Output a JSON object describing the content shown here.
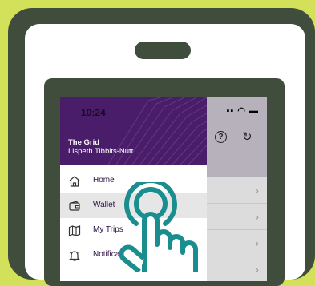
{
  "drawer": {
    "time": "10:24",
    "app_name": "The Grid",
    "user_name": "Lispeth Tibbits-Nutt",
    "items": [
      {
        "label": "Home",
        "icon": "home-icon",
        "active": false
      },
      {
        "label": "Wallet",
        "icon": "wallet-icon",
        "active": true
      },
      {
        "label": "My Trips",
        "icon": "map-icon",
        "active": false
      },
      {
        "label": "Notifications",
        "icon": "bell-icon",
        "active": false
      }
    ]
  },
  "colors": {
    "background": "#d3e15a",
    "frame": "#414d3c",
    "brand_purple": "#4a1d6a",
    "hand_teal": "#1a8d8f"
  }
}
